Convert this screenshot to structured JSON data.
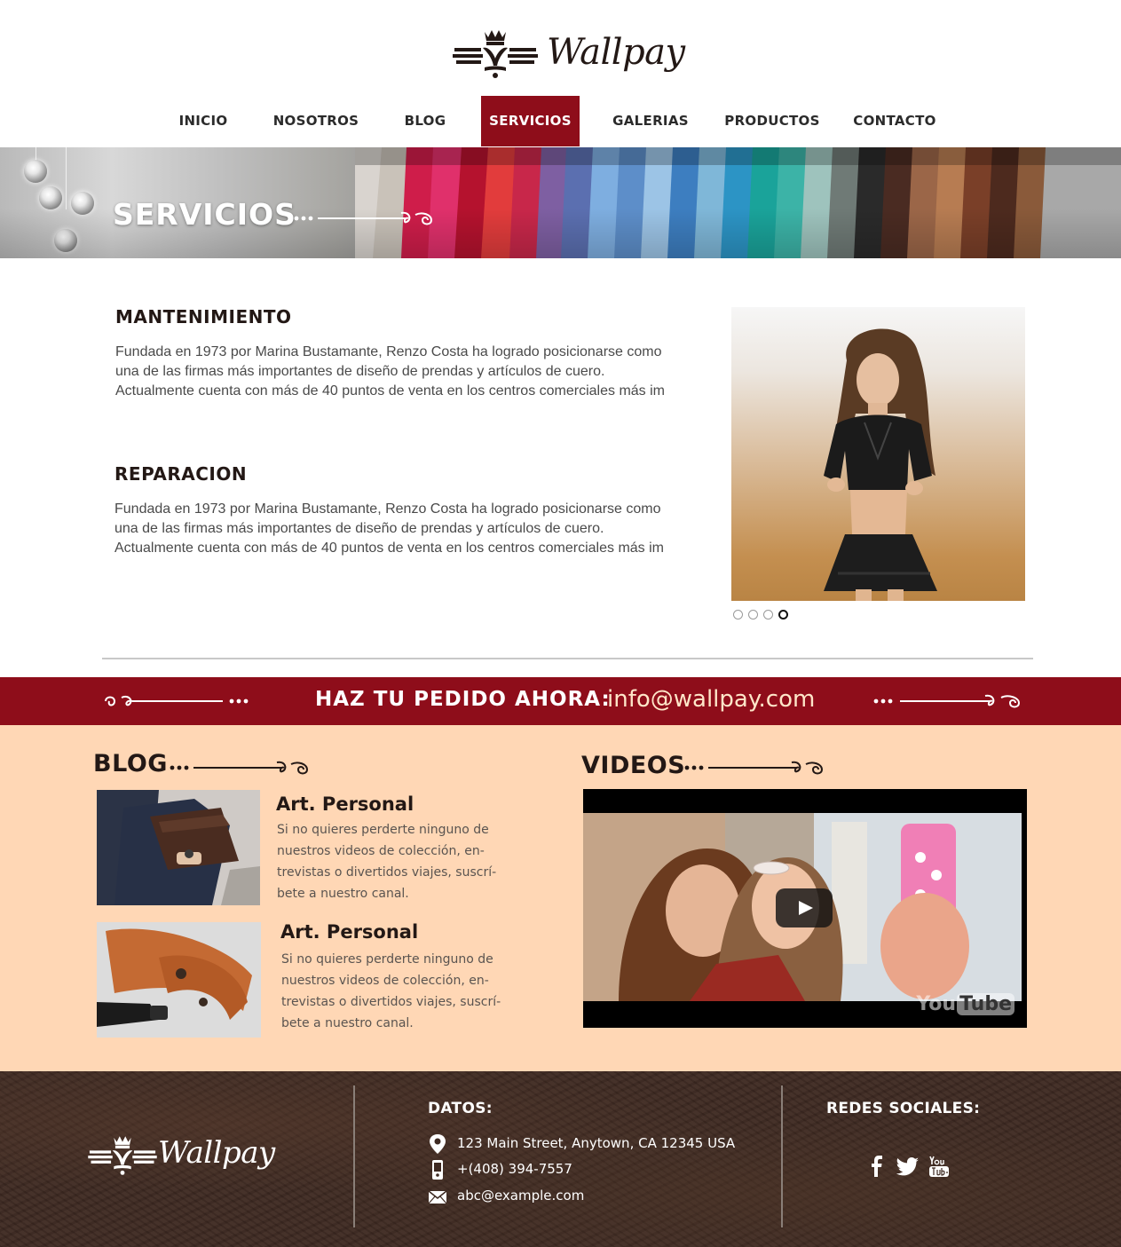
{
  "brand": {
    "name": "Wallpay"
  },
  "nav": {
    "items": [
      {
        "label": "INICIO"
      },
      {
        "label": "NOSOTROS"
      },
      {
        "label": "BLOG"
      },
      {
        "label": "SERVICIOS",
        "active": true
      },
      {
        "label": "GALERIAS"
      },
      {
        "label": "PRODUCTOS"
      },
      {
        "label": "CONTACTO"
      }
    ]
  },
  "banner": {
    "title": "SERVICIOS"
  },
  "services": [
    {
      "title": "MANTENIMIENTO",
      "lines": [
        "Fundada en 1973 por Marina Bustamante, Renzo Costa ha logrado posicionarse como",
        "una de las firmas más importantes de diseño de prendas y artículos de cuero.",
        "Actualmente cuenta con más de 40 puntos de venta en los centros comerciales más im"
      ]
    },
    {
      "title": "REPARACION",
      "lines": [
        "Fundada en 1973 por Marina Bustamante, Renzo Costa ha logrado posicionarse como",
        "una de las firmas más importantes de diseño de prendas y artículos de cuero.",
        "Actualmente cuenta con más de 40 puntos de venta en los centros comerciales más im"
      ]
    }
  ],
  "slider": {
    "slide_count": 4,
    "active_index": 3
  },
  "order": {
    "label": "HAZ TU PEDIDO AHORA:",
    "email": "info@wallpay.com"
  },
  "blog": {
    "title": "BLOG",
    "posts": [
      {
        "title": "Art. Personal",
        "lines": [
          "Si no quieres perderte ninguno de",
          "nuestros videos de colección, en-",
          "trevistas o divertidos viajes, suscrí-",
          "bete a nuestro canal."
        ]
      },
      {
        "title": "Art. Personal",
        "lines": [
          "Si no quieres perderte ninguno de",
          "nuestros videos de colección, en-",
          "trevistas o divertidos viajes, suscrí-",
          "bete a nuestro canal."
        ]
      }
    ]
  },
  "videos": {
    "title": "VIDEOS",
    "player_mark": "You",
    "player_mark_box": "Tube"
  },
  "footer": {
    "datos_title": "DATOS:",
    "address": "123 Main Street, Anytown, CA 12345 USA",
    "phone": "+(408) 394-7557",
    "email": "abc@example.com",
    "social_title": "REDES SOCIALES:",
    "social": [
      "facebook-icon",
      "twitter-icon",
      "youtube-icon"
    ]
  },
  "colors": {
    "brand_red": "#8e0d1a",
    "peach": "#ffd7b5",
    "dark": "#231815",
    "footer_brown": "#3e2a22"
  }
}
